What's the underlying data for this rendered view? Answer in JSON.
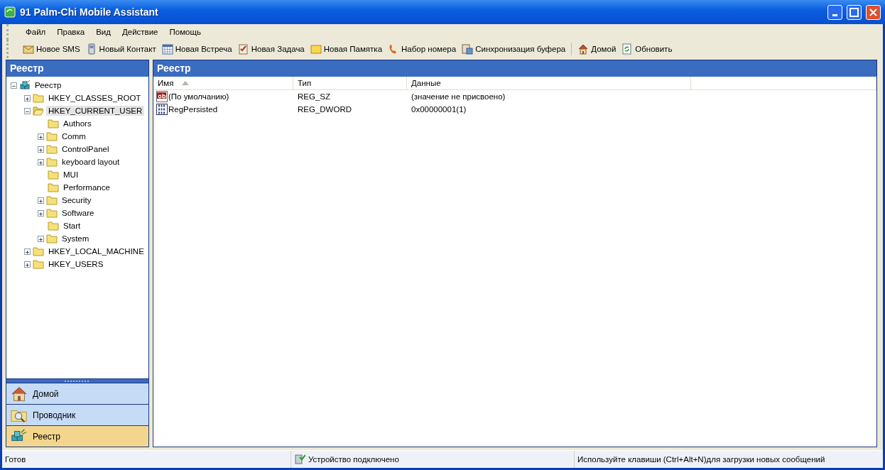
{
  "window": {
    "title": "91 Palm-Chi Mobile Assistant"
  },
  "menu": [
    "Файл",
    "Правка",
    "Вид",
    "Действие",
    "Помощь"
  ],
  "toolbar": [
    {
      "label": "Новое SMS"
    },
    {
      "label": "Новый Контакт"
    },
    {
      "label": "Новая Встреча"
    },
    {
      "label": "Новая Задача"
    },
    {
      "label": "Новая Памятка"
    },
    {
      "label": "Набор номера"
    },
    {
      "label": "Синхронизация буфера"
    },
    {
      "label": "Домой"
    },
    {
      "label": "Обновить"
    }
  ],
  "left_panel": {
    "title": "Реестр",
    "tree": [
      {
        "label": "Реестр",
        "expandable": true,
        "expanded": true,
        "selected": false,
        "children": [
          {
            "label": "HKEY_CLASSES_ROOT",
            "expandable": true,
            "expanded": false,
            "selected": false
          },
          {
            "label": "HKEY_CURRENT_USER",
            "expandable": true,
            "expanded": true,
            "selected": true,
            "children": [
              {
                "label": "Authors",
                "expandable": false,
                "expanded": false,
                "selected": false
              },
              {
                "label": "Comm",
                "expandable": true,
                "expanded": false,
                "selected": false
              },
              {
                "label": "ControlPanel",
                "expandable": true,
                "expanded": false,
                "selected": false
              },
              {
                "label": "keyboard layout",
                "expandable": true,
                "expanded": false,
                "selected": false
              },
              {
                "label": "MUI",
                "expandable": false,
                "expanded": false,
                "selected": false
              },
              {
                "label": "Performance",
                "expandable": false,
                "expanded": false,
                "selected": false
              },
              {
                "label": "Security",
                "expandable": true,
                "expanded": false,
                "selected": false
              },
              {
                "label": "Software",
                "expandable": true,
                "expanded": false,
                "selected": false
              },
              {
                "label": "Start",
                "expandable": false,
                "expanded": false,
                "selected": false
              },
              {
                "label": "System",
                "expandable": true,
                "expanded": false,
                "selected": false
              }
            ]
          },
          {
            "label": "HKEY_LOCAL_MACHINE",
            "expandable": true,
            "expanded": false,
            "selected": false
          },
          {
            "label": "HKEY_USERS",
            "expandable": true,
            "expanded": false,
            "selected": false
          }
        ]
      }
    ]
  },
  "nav": [
    {
      "label": "Домой",
      "selected": false
    },
    {
      "label": "Проводник",
      "selected": false
    },
    {
      "label": "Реестр",
      "selected": true
    }
  ],
  "right_panel": {
    "title": "Реестр",
    "columns": [
      "Имя",
      "Тип",
      "Данные"
    ],
    "rows": [
      {
        "kind": "string",
        "name": "(По умолчанию)",
        "type": "REG_SZ",
        "data": "(значение не присвоено)"
      },
      {
        "kind": "dword",
        "name": "RegPersisted",
        "type": "REG_DWORD",
        "data": "0x00000001(1)"
      }
    ]
  },
  "status_bar": {
    "state": "Готов",
    "device": "Устройство подключено",
    "hint": "Используйте клавиши (Ctrl+Alt+N)для загрузки новых сообщений"
  }
}
